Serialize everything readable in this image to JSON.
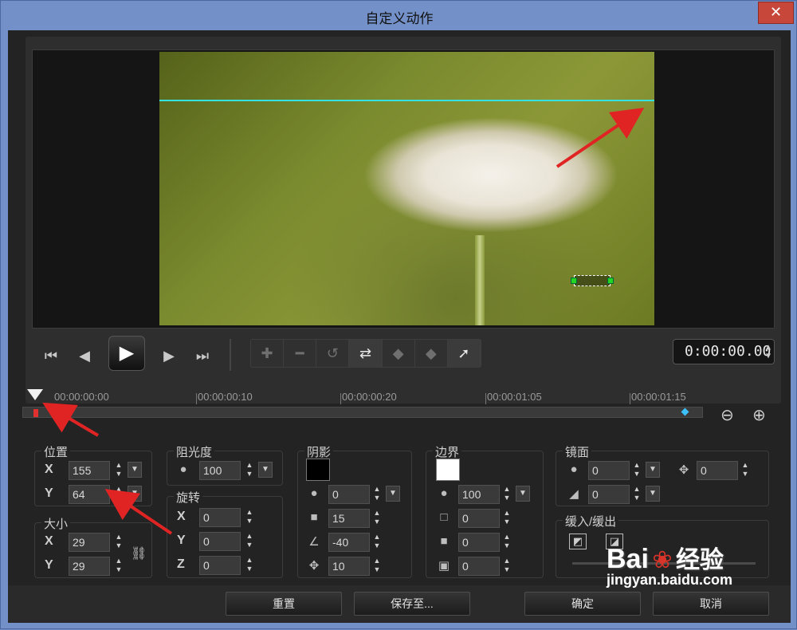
{
  "window": {
    "title": "自定义动作",
    "close_glyph": "✕"
  },
  "transport": {
    "go_start": "⏮",
    "prev_frame": "◀",
    "play": "▶",
    "next_frame": "▶",
    "go_end": "⏭",
    "timecode": "0:00:00.00"
  },
  "toolbar": {
    "tools": [
      "add-keyframe",
      "remove-keyframe",
      "reverse",
      "swap",
      "prev-keyframe",
      "next-keyframe",
      "goto-keyframe"
    ]
  },
  "timeline": {
    "labels": [
      "00:00:00:00",
      "00:00:00:10",
      "00:00:00:20",
      "00:00:01:05",
      "00:00:01:15"
    ]
  },
  "position": {
    "label": "位置",
    "x_label": "X",
    "x": "155",
    "y_label": "Y",
    "y": "64"
  },
  "size": {
    "label": "大小",
    "x_label": "X",
    "x": "29",
    "y_label": "Y",
    "y": "29"
  },
  "opacity": {
    "label": "阻光度",
    "value": "100"
  },
  "rotation": {
    "label": "旋转",
    "x_label": "X",
    "x": "0",
    "y_label": "Y",
    "y": "0",
    "z_label": "Z",
    "z": "0"
  },
  "shadow": {
    "label": "阴影",
    "color": "#000000",
    "opacity": "0",
    "blur": "15",
    "angle": "-40",
    "distance": "10"
  },
  "border": {
    "label": "边界",
    "color": "#ffffff",
    "opacity": "100",
    "width": "0",
    "v2": "0",
    "v3": "0"
  },
  "mirror": {
    "label": "镜面",
    "opacity": "0",
    "distance": "0",
    "v3": "0"
  },
  "fade": {
    "label": "缓入/缓出"
  },
  "buttons": {
    "reset": "重置",
    "save_to": "保存至...",
    "ok": "确定",
    "cancel": "取消"
  },
  "watermark": {
    "brand": "Bai",
    "brand2": "经验",
    "url": "jingyan.baidu.com"
  },
  "colors": {
    "accent_cyan": "#35e2e2",
    "annotation_red": "#e02424",
    "handle_green": "#24d624"
  }
}
